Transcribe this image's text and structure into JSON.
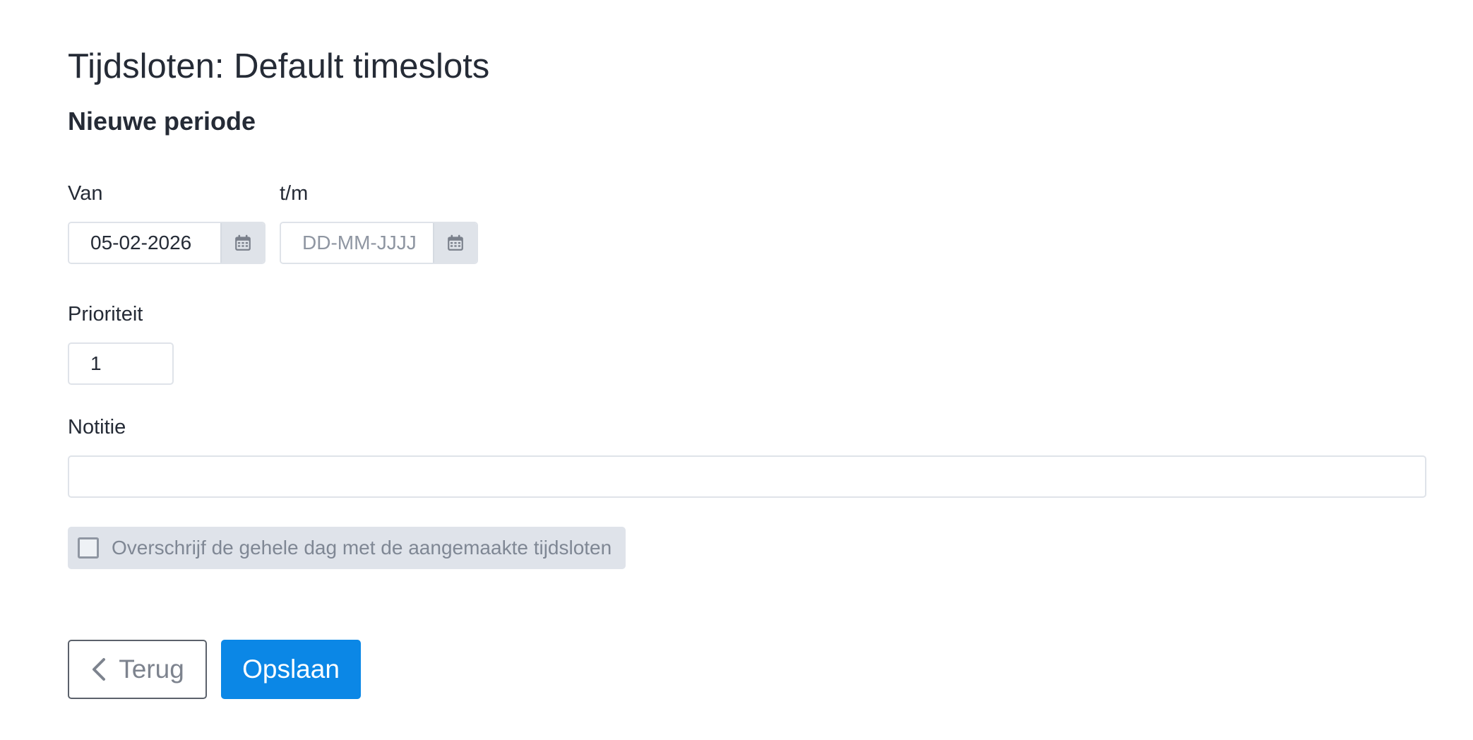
{
  "page": {
    "title": "Tijdsloten: Default timeslots",
    "section_title": "Nieuwe periode"
  },
  "form": {
    "from": {
      "label": "Van",
      "value": "05-02-2026",
      "placeholder": "DD-MM-JJJJ",
      "icon": "calendar-icon"
    },
    "to": {
      "label": "t/m",
      "value": "",
      "placeholder": "DD-MM-JJJJ",
      "icon": "calendar-icon"
    },
    "priority": {
      "label": "Prioriteit",
      "value": "1"
    },
    "note": {
      "label": "Notitie",
      "value": ""
    },
    "overwrite": {
      "label": "Overschrijf de gehele dag met de aangemaakte tijdsloten",
      "checked": false
    }
  },
  "actions": {
    "back_label": "Terug",
    "back_icon": "chevron-left-icon",
    "save_label": "Opslaan"
  },
  "colors": {
    "primary": "#0b87e6",
    "text": "#252b36",
    "muted": "#8f96a2",
    "input_border": "#dfe3e9"
  }
}
